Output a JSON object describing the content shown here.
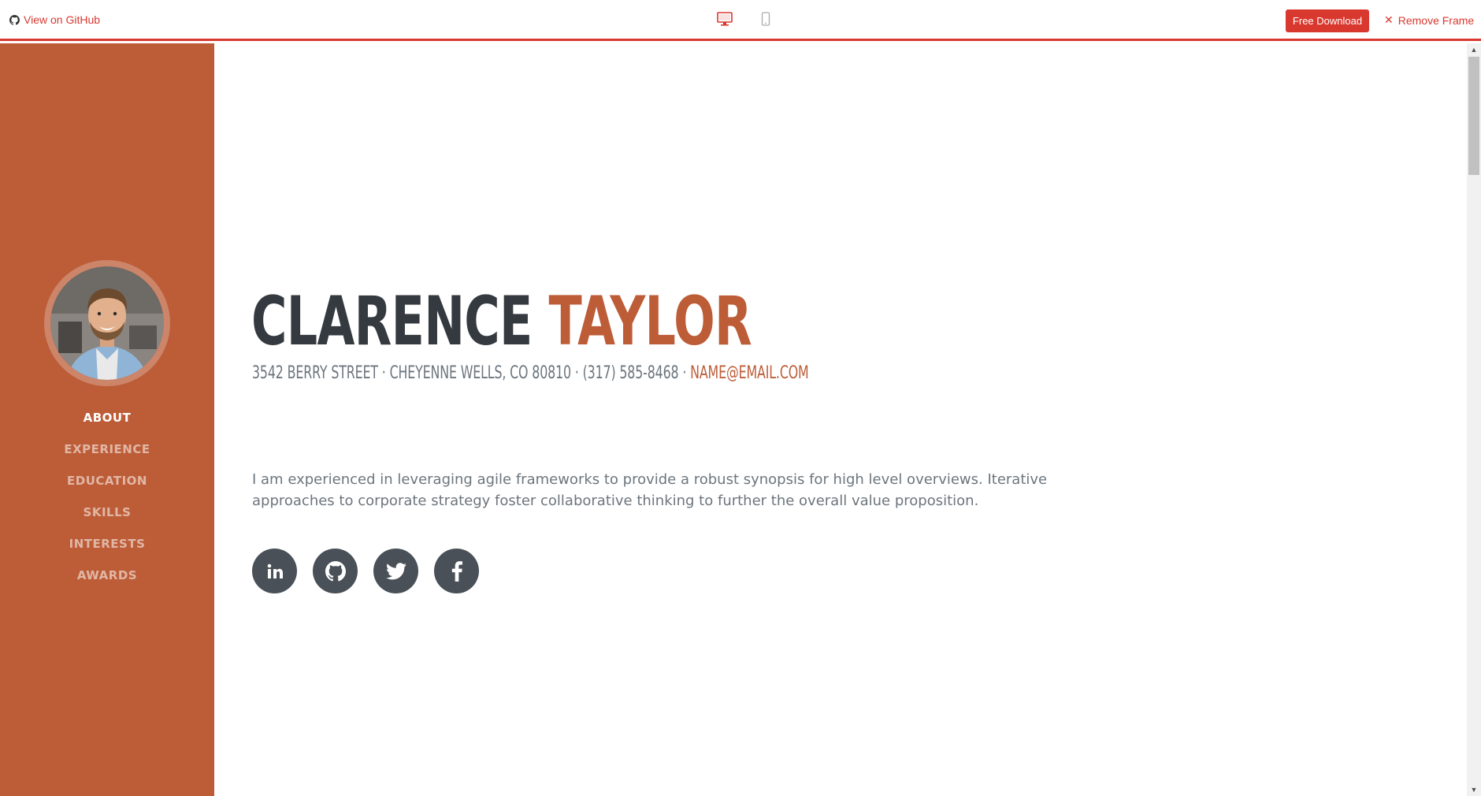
{
  "frame": {
    "github_label": "View on GitHub",
    "download_label": "Free Download",
    "remove_label": "Remove Frame",
    "remove_glyph": "✕",
    "accent": "#d9382f"
  },
  "sidebar": {
    "background": "#bd5d38",
    "nav": [
      {
        "label": "ABOUT",
        "active": true
      },
      {
        "label": "EXPERIENCE",
        "active": false
      },
      {
        "label": "EDUCATION",
        "active": false
      },
      {
        "label": "SKILLS",
        "active": false
      },
      {
        "label": "INTERESTS",
        "active": false
      },
      {
        "label": "AWARDS",
        "active": false
      }
    ]
  },
  "profile": {
    "first_name": "CLARENCE",
    "last_name": "TAYLOR",
    "address": "3542 BERRY STREET · CHEYENNE WELLS, CO 80810 · (317) 585-8468 ·",
    "email": "NAME@EMAIL.COM",
    "bio": "I am experienced in leveraging agile frameworks to provide a robust synopsis for high level overviews. Iterative approaches to corporate strategy foster collaborative thinking to further the overall value proposition."
  },
  "socials": [
    {
      "icon": "linkedin-icon"
    },
    {
      "icon": "github-icon"
    },
    {
      "icon": "twitter-icon"
    },
    {
      "icon": "facebook-icon"
    }
  ],
  "scrollbar": {
    "up_glyph": "▲",
    "down_glyph": "▼"
  }
}
